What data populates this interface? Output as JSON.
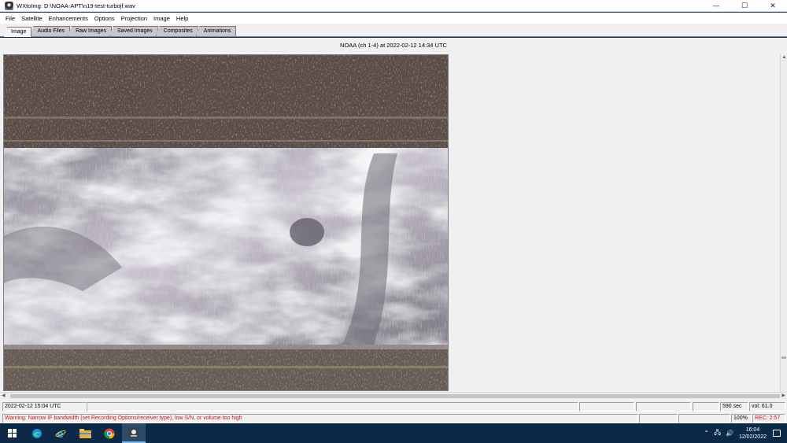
{
  "window": {
    "title": "WXtoImg: D:\\NOAA-APT\\n19-test-turbojf.wav",
    "minimize": "—",
    "maximize": "☐",
    "close": "✕"
  },
  "menu": [
    "File",
    "Satellite",
    "Enhancements",
    "Options",
    "Projection",
    "Image",
    "Help"
  ],
  "tabs": [
    {
      "label": "Image",
      "active": true
    },
    {
      "label": "Audio Files",
      "active": false
    },
    {
      "label": "Raw Images",
      "active": false
    },
    {
      "label": "Saved Images",
      "active": false
    },
    {
      "label": "Composites",
      "active": false
    },
    {
      "label": "Animations",
      "active": false
    }
  ],
  "image": {
    "caption": "NOAA (ch 1-4) at 2022-02-12  14:34 UTC"
  },
  "status": {
    "datetime": "2022-02-12  15:04 UTC",
    "seconds": "590 sec",
    "volume": "vol: 61.0",
    "warning": "Warning: Narrow IF bandwidth (set Recording Options/receiver type), low S/N, or volume too high",
    "zoom": "100%",
    "rec": "REC: 2:57"
  },
  "taskbar": {
    "time": "16:04",
    "date": "12/02/2022",
    "apps": [
      "start-icon",
      "edge-icon",
      "ie-icon",
      "file-explorer-icon",
      "chrome-icon",
      "wxtoimg-icon"
    ]
  },
  "colors": {
    "warning": "#d01010",
    "taskbar": "#0c2a47",
    "noise_band": "#5a4d47"
  }
}
